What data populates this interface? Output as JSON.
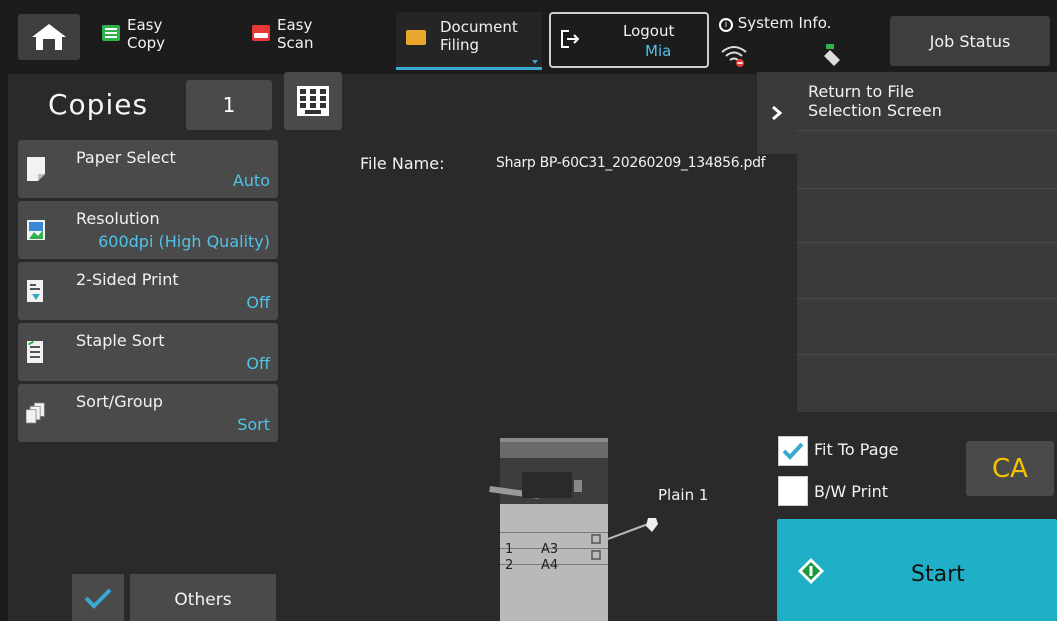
{
  "topbar": {
    "easy_copy": "Easy\nCopy",
    "easy_copy_l1": "Easy",
    "easy_copy_l2": "Copy",
    "easy_scan_l1": "Easy",
    "easy_scan_l2": "Scan",
    "doc_filing_l1": "Document",
    "doc_filing_l2": "Filing",
    "logout_label": "Logout",
    "logout_user": "Mia",
    "system_info": "System Info.",
    "job_status": "Job Status"
  },
  "copies": {
    "label": "Copies",
    "value": "1"
  },
  "functions": [
    {
      "title": "Paper Select",
      "value": "Auto",
      "icon": "paper-icon"
    },
    {
      "title": "Resolution",
      "value": "600dpi (High Quality)",
      "icon": "resolution-icon"
    },
    {
      "title": "2-Sided Print",
      "value": "Off",
      "icon": "duplex-icon"
    },
    {
      "title": "Staple Sort",
      "value": "Off",
      "icon": "staple-icon"
    },
    {
      "title": "Sort/Group",
      "value": "Sort",
      "icon": "sort-icon"
    }
  ],
  "others_label": "Others",
  "file": {
    "label": "File Name:",
    "value": "Sharp BP-60C31_20260209_134856.pdf"
  },
  "tray": {
    "selected": "Plain 1",
    "trays": [
      {
        "num": "1",
        "size": "A3"
      },
      {
        "num": "2",
        "size": "A4"
      }
    ]
  },
  "right": {
    "return_l1": "Return to File",
    "return_l2": "Selection Screen",
    "fit_to_page": "Fit To Page",
    "fit_to_page_checked": true,
    "bw_print": "B/W Print",
    "bw_print_checked": false,
    "ca": "CA",
    "start": "Start"
  },
  "colors": {
    "accent": "#4fc3e8",
    "start": "#1fb0c8",
    "ca": "#f5c400"
  }
}
